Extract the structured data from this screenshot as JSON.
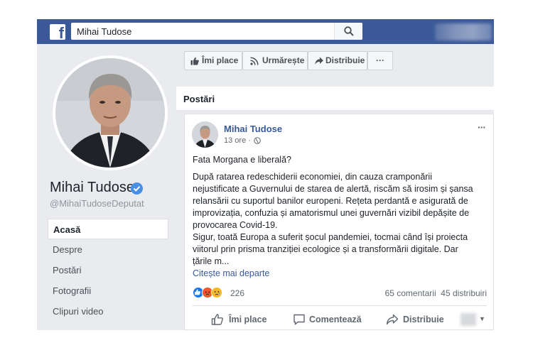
{
  "topbar": {
    "logo_glyph": "f",
    "search_value": "Mihai Tudose",
    "brand_color": "#3b5998"
  },
  "profile": {
    "name": "Mihai Tudose",
    "handle": "@MihaiTudoseDeputat",
    "verified": true
  },
  "nav": {
    "items": [
      "Acasă",
      "Despre",
      "Postări",
      "Fotografii",
      "Clipuri video"
    ],
    "active_index": 0
  },
  "page_actions": {
    "like": "Îmi place",
    "follow": "Urmărește",
    "share": "Distribuie",
    "more": "···"
  },
  "posts": {
    "header": "Postări"
  },
  "post": {
    "author": "Mihai Tudose",
    "time": "13 ore ·",
    "more": "···",
    "lines": [
      "Fata Morgana e liberală?",
      "După ratarea redeschiderii economiei, din cauza cramponării",
      "nejustificate a Guvernului de starea de alertă, riscăm să irosim și șansa",
      "relansării cu suportul banilor europeni. Rețeta perdantă e asigurată de",
      "improvizația, confuzia și amatorismul unei guvernări vizibil depășite de",
      "provocarea Covid-19.",
      "Sigur, toată Europa a suferit șocul pandemiei, tocmai când își proiecta",
      "viitorul prin prisma tranziției ecologice și a transformării digitale. Dar",
      "țările m..."
    ],
    "see_more": "Citește mai departe",
    "reaction_count": "226",
    "comments": "65 comentarii",
    "shares": "45 distribuiri",
    "actions": {
      "like": "Îmi place",
      "comment": "Comentează",
      "share": "Distribuie"
    }
  }
}
